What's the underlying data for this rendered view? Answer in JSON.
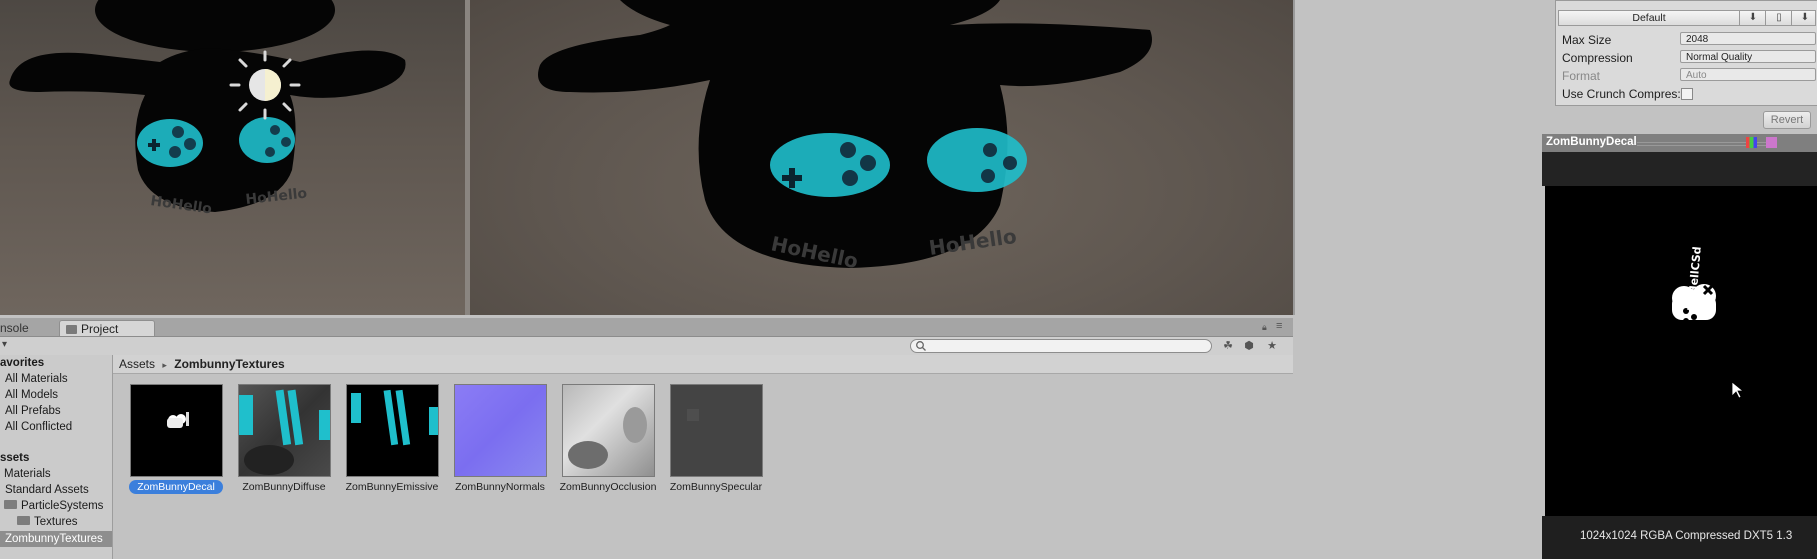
{
  "project_tabs": {
    "console_label": "nsole",
    "project_label": "Project"
  },
  "sidebar": {
    "favorites_header": "avorites",
    "favorites": [
      "All Materials",
      "All Models",
      "All Prefabs",
      "All Conflicted"
    ],
    "assets_header": "ssets",
    "assets": [
      "Materials",
      "Standard Assets",
      "ParticleSystems",
      "Textures",
      "ZombunnyTextures"
    ]
  },
  "breadcrumb": {
    "root": "Assets",
    "separator": "▸",
    "current": "ZombunnyTextures"
  },
  "textures": [
    {
      "label": "ZomBunnyDecal",
      "selected": true
    },
    {
      "label": "ZomBunnyDiffuse"
    },
    {
      "label": "ZomBunnyEmissive"
    },
    {
      "label": "ZomBunnyNormals"
    },
    {
      "label": "ZomBunnyOcclusion"
    },
    {
      "label": "ZomBunnySpecular"
    }
  ],
  "inspector": {
    "platform_label": "Default",
    "max_size_label": "Max Size",
    "max_size_value": "2048",
    "compression_label": "Compression",
    "compression_value": "Normal Quality",
    "format_label": "Format",
    "format_value": "Auto",
    "crunch_label": "Use Crunch Compres:",
    "revert_label": "Revert"
  },
  "preview": {
    "title": "ZomBunnyDecal",
    "info": "1024x1024  RGBA Compressed DXT5   1.3",
    "decal_text": "HoHellCSd"
  },
  "bunny_text": "HoHello",
  "colors": {
    "accent": "#3b7fdc",
    "emissive_cyan": "#1fc7d4",
    "scene_floor": "#5f5750"
  }
}
